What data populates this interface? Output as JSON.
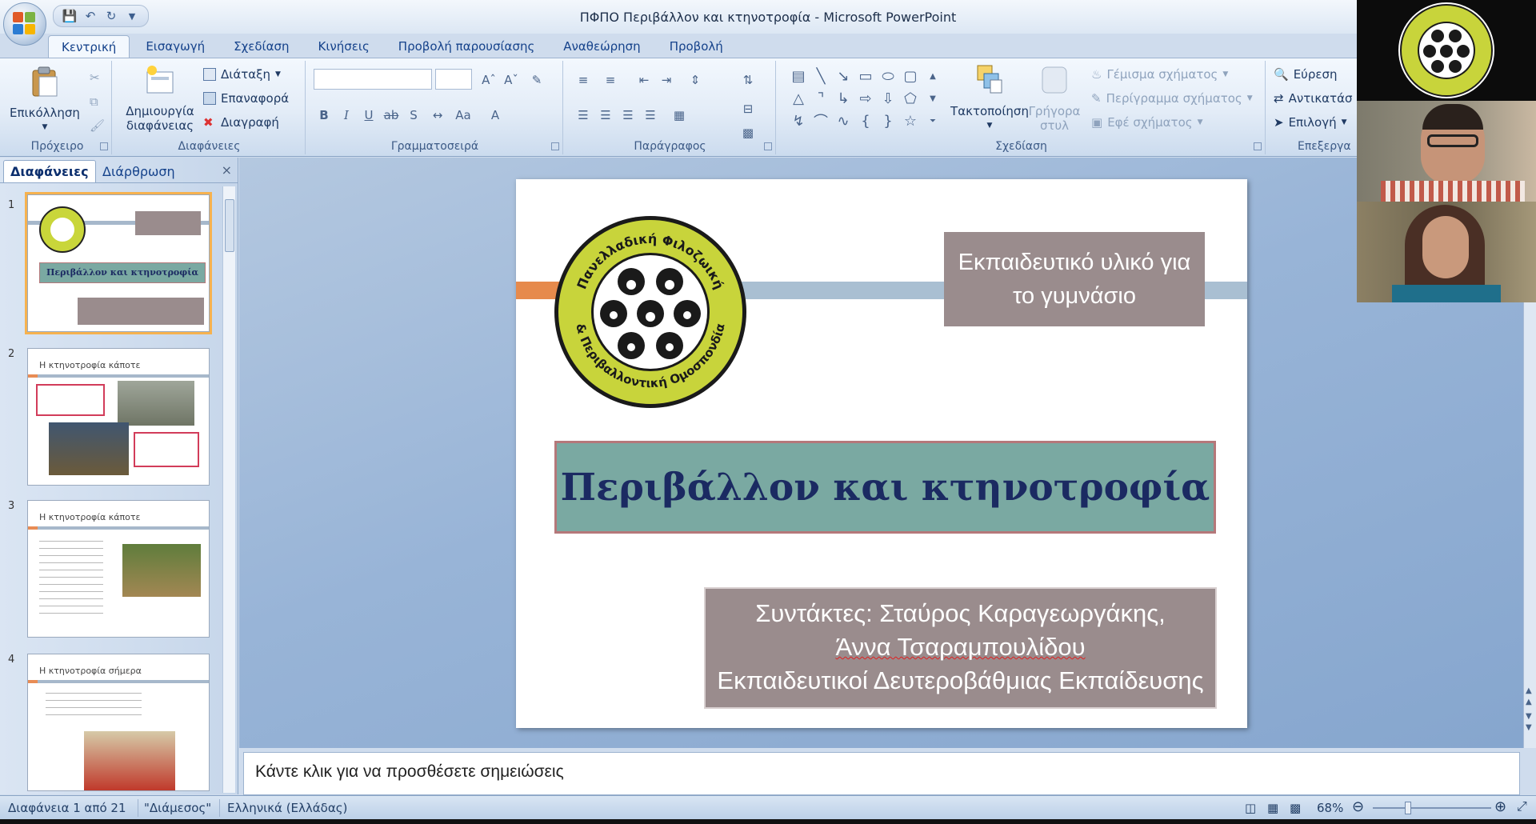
{
  "window": {
    "title": "ΠΦΠΟ Περιβάλλον και κτηνοτροφία - Microsoft PowerPoint"
  },
  "tabs": [
    "Κεντρική",
    "Εισαγωγή",
    "Σχεδίαση",
    "Κινήσεις",
    "Προβολή παρουσίασης",
    "Αναθεώρηση",
    "Προβολή"
  ],
  "ribbon": {
    "clipboard": {
      "paste": "Επικόλληση",
      "label": "Πρόχειρο"
    },
    "slides": {
      "new_slide_1": "Δημιουργία",
      "new_slide_2": "διαφάνειας",
      "layout": "Διάταξη",
      "reset": "Επαναφορά",
      "delete": "Διαγραφή",
      "label": "Διαφάνειες"
    },
    "font": {
      "label": "Γραμματοσειρά"
    },
    "paragraph": {
      "label": "Παράγραφος"
    },
    "drawing": {
      "arrange": "Τακτοποίηση",
      "quick_styles_1": "Γρήγορα",
      "quick_styles_2": "στυλ",
      "shape_fill": "Γέμισμα σχήματος",
      "shape_outline": "Περίγραμμα σχήματος",
      "shape_effects": "Εφέ σχήματος",
      "label": "Σχεδίαση"
    },
    "editing": {
      "find": "Εύρεση",
      "replace": "Αντικατάσ",
      "select": "Επιλογή",
      "label": "Επεξεργα"
    }
  },
  "panel": {
    "tab_slides": "Διαφάνειες",
    "tab_outline": "Διάρθρωση",
    "close": "×",
    "thumbs": [
      {
        "num": "1",
        "title": "Περιβάλλον και κτηνοτροφία"
      },
      {
        "num": "2",
        "title": "Η κτηνοτροφία κάποτε"
      },
      {
        "num": "3",
        "title": "Η κτηνοτροφία κάποτε"
      },
      {
        "num": "4",
        "title": "Η κτηνοτροφία σήμερα"
      }
    ]
  },
  "slide": {
    "subtitle": "Εκπαιδευτικό υλικό για το γυμνάσιο",
    "title": "Περιβάλλον και κτηνοτροφία",
    "authors_prefix": "Συντάκτες: Σταύρος Καραγεωργάκης,",
    "author2": "Άννα Τσαραμπουλίδου",
    "role": "Εκπαιδευτικοί Δευτεροβάθμιας Εκπαίδευσης",
    "logo_top": "Πανελλαδική Φιλοζωική",
    "logo_bottom": "& Περιβαλλοντική Ομοσπονδία"
  },
  "notes": {
    "placeholder": "Κάντε κλικ για να προσθέσετε σημειώσεις"
  },
  "status": {
    "slide_count": "Διαφάνεια 1 από 21",
    "theme": "\"Διάμεσος\"",
    "language": "Ελληνικά (Ελλάδας)",
    "zoom": "68%"
  },
  "colors": {
    "accent_orange": "#e68a4c",
    "title_box": "#7aa9a2",
    "grey_box": "#9a8c8d",
    "title_text": "#1b2a62"
  }
}
